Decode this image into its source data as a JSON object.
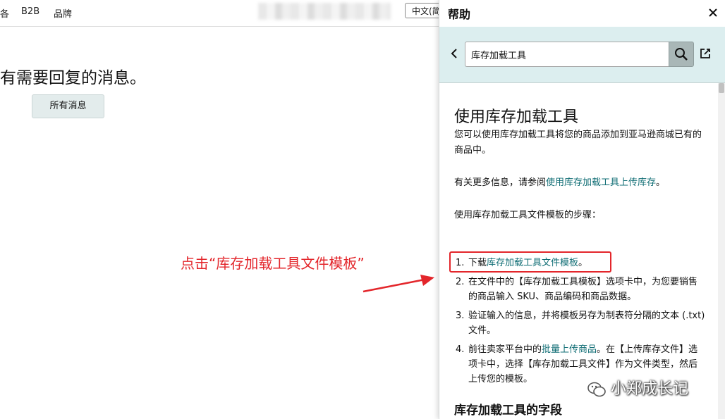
{
  "topnav": {
    "items": [
      "各",
      "B2B",
      "品牌"
    ],
    "language": "中文(简"
  },
  "left": {
    "heading": "有需要回复的消息。",
    "all_messages_button": "所有消息",
    "annotation": "点击“库存加载工具文件模板”"
  },
  "help": {
    "title": "帮助",
    "search_value": "库存加载工具",
    "article_title": "使用库存加载工具",
    "intro": "您可以使用库存加载工具将您的商品添加到亚马逊商城已有的商品中。",
    "more_info_prefix": "有关更多信息，请参阅",
    "more_info_link": "使用库存加载工具上传库存",
    "more_info_suffix": "。",
    "steps_intro": "使用库存加载工具文件模板的步骤：",
    "steps": [
      {
        "num": "1.",
        "prefix": "下载",
        "link": "库存加载工具文件模板",
        "suffix": "。"
      },
      {
        "num": "2.",
        "text": "在文件中的【库存加载工具模板】选项卡中，为您要销售的商品输入 SKU、商品编码和商品数据。"
      },
      {
        "num": "3.",
        "text": "验证输入的信息，并将模板另存为制表符分隔的文本 (.txt) 文件。"
      },
      {
        "num": "4.",
        "prefix": "前往卖家平台中的",
        "link": "批量上传商品",
        "suffix": "。在【上传库存文件】选项卡中，选择【库存加载工具文件】作为文件类型，然后上传您的模板。"
      }
    ],
    "section_heading": "库存加载工具的字段"
  },
  "watermark": "小郑成长记",
  "colors": {
    "link": "#0f6d74",
    "annotation": "#e3262b",
    "search_bar_bg": "#dceeef"
  }
}
